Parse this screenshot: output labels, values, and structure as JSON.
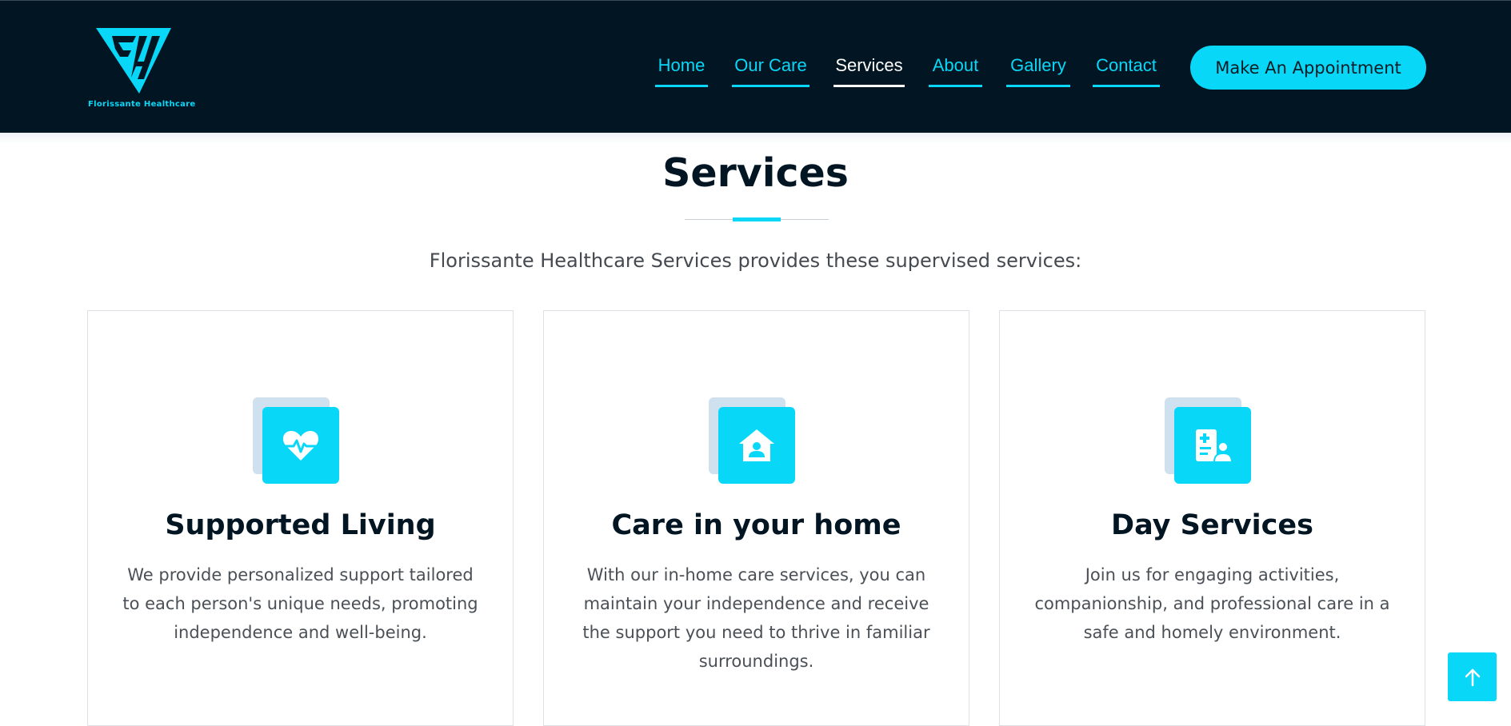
{
  "brand": {
    "name": "Florissante Healthcare",
    "accent_color": "#08d7f8",
    "header_color": "#021522"
  },
  "nav": {
    "items": [
      {
        "label": "Home",
        "active": false
      },
      {
        "label": "Our Care",
        "active": false
      },
      {
        "label": "Services",
        "active": true
      },
      {
        "label": "About",
        "active": false
      },
      {
        "label": "Gallery",
        "active": false
      },
      {
        "label": "Contact",
        "active": false
      }
    ],
    "cta_label": "Make An Appointment"
  },
  "section": {
    "title": "Services",
    "subtitle": "Florissante Healthcare Services provides these supervised services:"
  },
  "cards": [
    {
      "icon": "heart-pulse-icon",
      "title": "Supported Living",
      "text": "We provide personalized support tailored to each person's unique needs, promoting independence and well-being."
    },
    {
      "icon": "home-user-icon",
      "title": "Care in your home",
      "text": "With our in-home care services, you can maintain your independence and receive the support you need to thrive in familiar surroundings."
    },
    {
      "icon": "medical-record-user-icon",
      "title": "Day Services",
      "text": "Join us for engaging activities, companionship, and professional care in a safe and homely environment."
    }
  ],
  "back_to_top_icon": "arrow-up-icon"
}
